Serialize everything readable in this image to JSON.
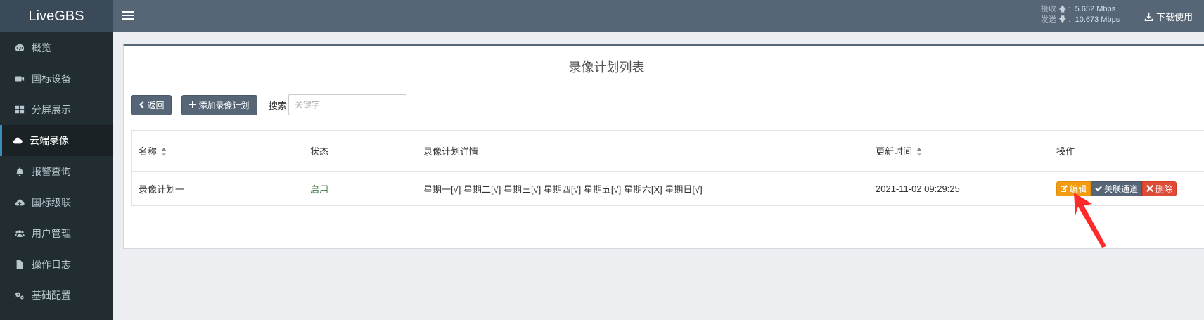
{
  "brand": "LiveGBS",
  "sidebar": {
    "items": [
      {
        "label": "概览",
        "icon": "dashboard-icon"
      },
      {
        "label": "国标设备",
        "icon": "video-camera-icon"
      },
      {
        "label": "分屏展示",
        "icon": "grid-icon"
      },
      {
        "label": "云端录像",
        "icon": "cloud-icon",
        "active": true
      },
      {
        "label": "报警查询",
        "icon": "bell-icon"
      },
      {
        "label": "国标级联",
        "icon": "cloud-upload-icon"
      },
      {
        "label": "用户管理",
        "icon": "users-icon"
      },
      {
        "label": "操作日志",
        "icon": "file-icon"
      },
      {
        "label": "基础配置",
        "icon": "gears-icon"
      }
    ]
  },
  "header": {
    "net": {
      "recv_label": "接收",
      "recv_value": "5.652 Mbps",
      "send_label": "发送",
      "send_value": "10.673 Mbps"
    },
    "download_label": "下载使用"
  },
  "main": {
    "title": "录像计划列表",
    "back_label": "返回",
    "add_label": "添加录像计划",
    "search_label": "搜索",
    "search_placeholder": "关键字",
    "table": {
      "headers": {
        "name": "名称",
        "status": "状态",
        "detail": "录像计划详情",
        "updated": "更新时间",
        "ops": "操作"
      },
      "rows": [
        {
          "name": "录像计划一",
          "status": "启用",
          "detail": "星期一[√] 星期二[√] 星期三[√] 星期四[√] 星期五[√] 星期六[X] 星期日[√]",
          "updated": "2021-11-02 09:29:25"
        }
      ],
      "actions": {
        "edit": "编辑",
        "link": "关联通道",
        "delete": "删除"
      }
    }
  },
  "colors": {
    "header_bg": "#566677",
    "sidebar_bg": "#222d32",
    "edit": "#f39c12",
    "delete": "#dd4b39",
    "status_on": "#3c763d",
    "annotation_arrow": "#ff2a2a"
  }
}
